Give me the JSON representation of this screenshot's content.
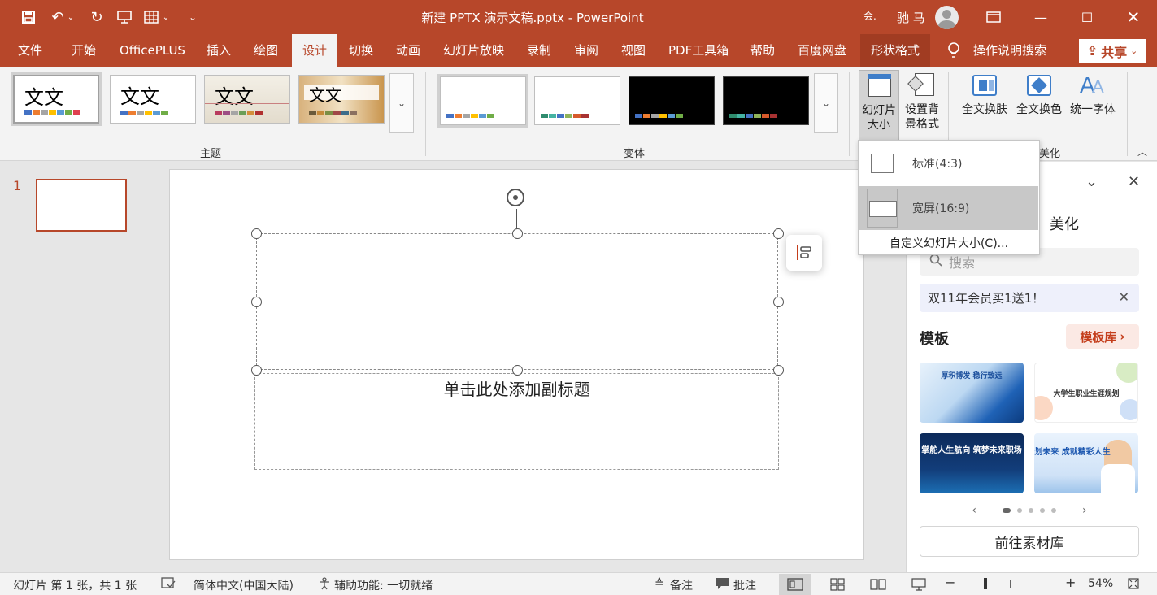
{
  "titlebar": {
    "doc_title": "新建 PPTX 演示文稿.pptx  -  PowerPoint",
    "user_badge": "会.",
    "user_name": "驰 马"
  },
  "tabs": [
    "文件",
    "开始",
    "OfficePLUS",
    "插入",
    "绘图",
    "设计",
    "切换",
    "动画",
    "幻灯片放映",
    "录制",
    "审阅",
    "视图",
    "PDF工具箱",
    "帮助",
    "百度网盘",
    "形状格式"
  ],
  "active_tab": "设计",
  "tell_me": "操作说明搜索",
  "share": "共享",
  "ribbon": {
    "themes": [
      {
        "text": "文文"
      },
      {
        "text": "文文"
      },
      {
        "text": "文文"
      },
      {
        "text": "文文"
      }
    ],
    "themes_group": "主题",
    "variants_group": "变体",
    "slide_size_line1": "幻灯片",
    "slide_size_line2": "大小",
    "bg_format_line1": "设置背",
    "bg_format_line2": "景格式",
    "change_skin": "全文换肤",
    "change_color": "全文换色",
    "unify_font": "统一字体",
    "beautify_group": "美化"
  },
  "dropdown": {
    "standard": "标准(4:3)",
    "widescreen": "宽屏(16:9)",
    "custom": "自定义幻灯片大小(C)..."
  },
  "thumbnails": {
    "slide_number": "1"
  },
  "slide": {
    "subtitle_placeholder": "单击此处添加副标题"
  },
  "task_pane": {
    "tab": "美化",
    "search_placeholder": "搜索",
    "promo": "双11年会员买1送1！",
    "templates_title": "模板",
    "template_library": "模板库",
    "templates": [
      {
        "title": "厚积博发  稳行致远"
      },
      {
        "title": "大学生职业生涯规划"
      },
      {
        "title": "掌舵人生航向 筑梦未来职场"
      },
      {
        "title": "规划未来 成就精彩人生"
      }
    ],
    "go_library": "前往素材库"
  },
  "status": {
    "slide_info": "幻灯片 第 1 张，共 1 张",
    "language": "简体中文(中国大陆)",
    "accessibility": "辅助功能: 一切就绪",
    "notes": "备注",
    "comments": "批注",
    "zoom": "54%"
  },
  "colors": {
    "accent": "#b7472a",
    "ribbon_bg": "#f3f3f3"
  }
}
